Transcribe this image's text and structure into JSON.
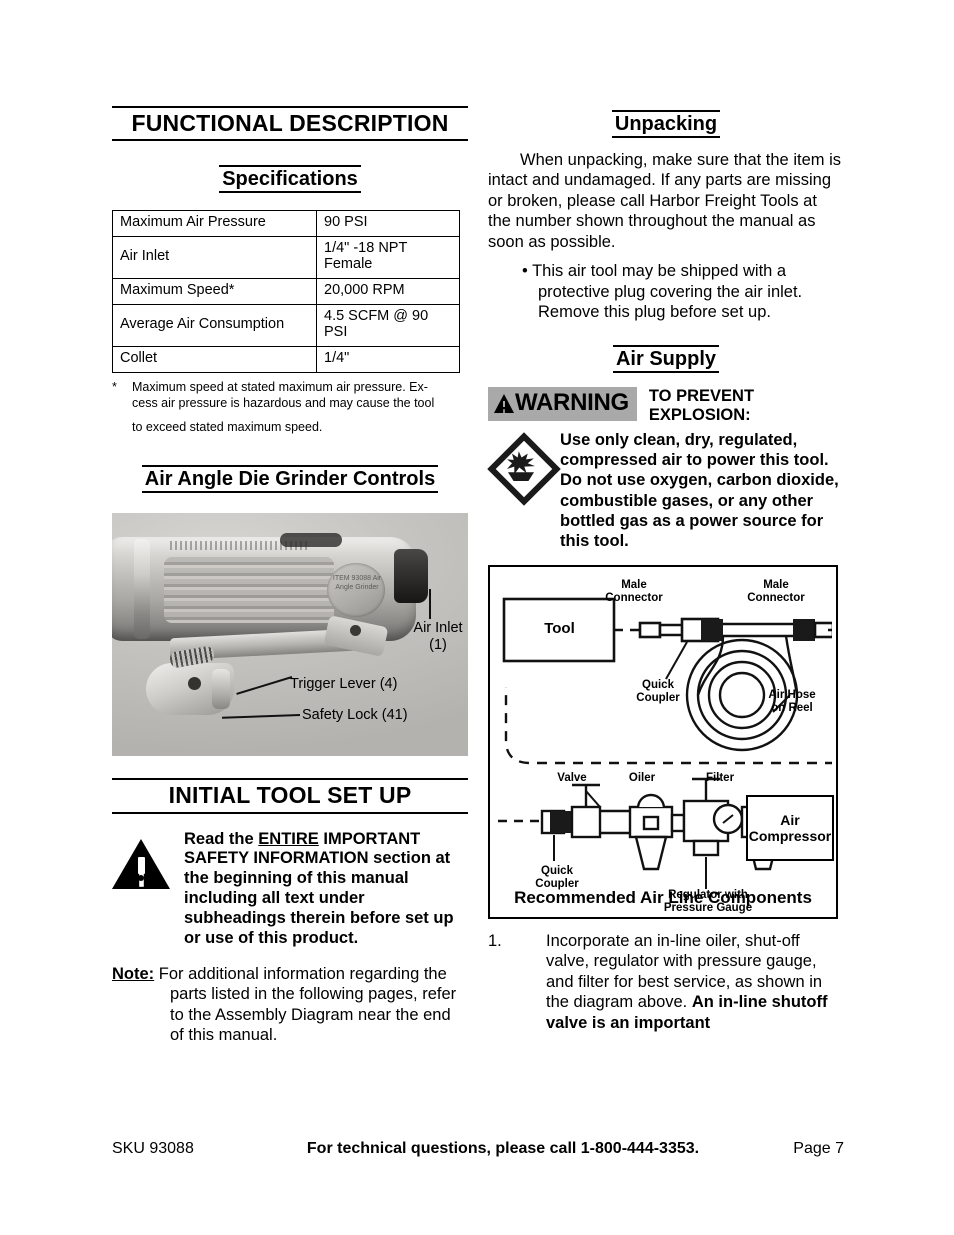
{
  "left": {
    "section_title": "FUNCTIONAL DESCRIPTION",
    "specs_title": "Specifications",
    "spec_table": {
      "rows": [
        {
          "key": "Maximum Air Pressure",
          "value": "90 PSI"
        },
        {
          "key": "Air Inlet",
          "value": "1/4\" -18 NPT Female"
        },
        {
          "key": "Maximum Speed*",
          "value": "20,000 RPM"
        },
        {
          "key": "Average Air Consumption",
          "value": "4.5 SCFM @ 90 PSI"
        },
        {
          "key": "Collet",
          "value": "1/4\""
        }
      ]
    },
    "footnote": {
      "marker": "*",
      "line1": "Maximum speed at stated maximum air pressure.  Ex-",
      "line2": "cess air pressure is hazardous and may cause the tool",
      "line3": "to exceed stated maximum speed."
    },
    "controls_title": "Air Angle Die Grinder Controls",
    "photo": {
      "badge_text": "ITEM 93088 Air Angle Grinder",
      "callouts": {
        "air_inlet": "Air Inlet",
        "air_inlet_num": "(1)",
        "trigger_lever": "Trigger Lever (4)",
        "safety_lock": "Safety Lock (41)"
      }
    },
    "setup_title": "INITIAL TOOL SET UP",
    "setup_warning": {
      "pre": "Read the ",
      "underlined": "ENTIRE",
      "post": " IMPORTANT SAFETY INFORMATION section at the beginning of this manual including all text under subheadings therein before set up or use of this product."
    },
    "note": {
      "label": "Note:",
      "text": "For additional information regarding the parts listed in the following pages, refer to the Assembly Diagram near the end of this manual."
    }
  },
  "right": {
    "unpacking_title": "Unpacking",
    "unpacking_body": "When unpacking, make sure that the item is intact and undamaged.  If any parts are missing or broken, please call Harbor Freight Tools at the number shown throughout the manual as soon as possible.",
    "unpacking_bullet": "•  This air tool may be shipped with a protective plug covering the air inlet.  Remove this plug before set up.",
    "air_supply_title": "Air Supply",
    "warning": {
      "badge": "WARNING",
      "heading_line1": "TO PREVENT",
      "heading_line2": "EXPLOSION:",
      "body": "Use only clean, dry, regulated, compressed air to power this tool.  Do not use oxygen, carbon dioxide, combustible gases, or any other bottled gas as a power source for this tool."
    },
    "diagram": {
      "caption": "Recommended Air Line Components",
      "tool": "Tool",
      "male_connector_left_l1": "Male",
      "male_connector_left_l2": "Connector",
      "male_connector_right_l1": "Male",
      "male_connector_right_l2": "Connector",
      "quick_coupler_top_l1": "Quick",
      "quick_coupler_top_l2": "Coupler",
      "air_hose_l1": "Air Hose",
      "air_hose_l2": "on Reel",
      "valve": "Valve",
      "oiler": "Oiler",
      "filter": "Filter",
      "quick_coupler_bottom_l1": "Quick",
      "quick_coupler_bottom_l2": "Coupler",
      "regulator_l1": "Regulator with",
      "regulator_l2": "Pressure Gauge",
      "air_compressor_l1": "Air",
      "air_compressor_l2": "Compressor"
    },
    "list": {
      "number": "1.",
      "text_normal": "Incorporate an in-line oiler, shut-off valve, regulator with pressure gauge, and filter for best service, as shown in the diagram above.  ",
      "text_bold": "An in-line shutoff valve is an important"
    }
  },
  "footer": {
    "sku": "SKU 93088",
    "center": "For technical questions, please call 1-800-444-3353.",
    "page": "Page 7"
  },
  "colors": {
    "warning_badge_bg": "#a9a9a9",
    "text": "#000000",
    "background": "#ffffff"
  }
}
